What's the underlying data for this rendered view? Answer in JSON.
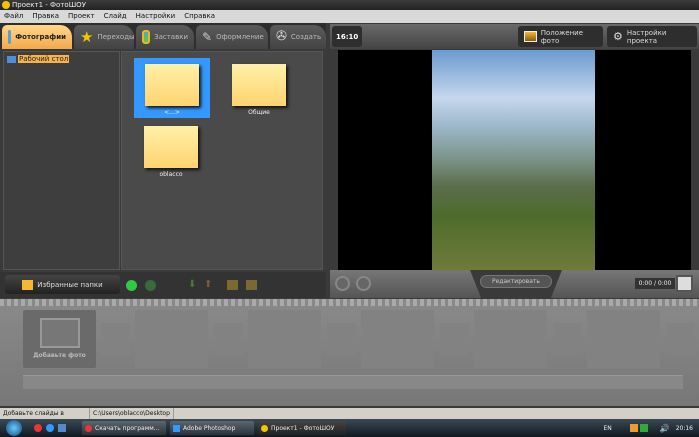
{
  "window": {
    "title": "Проект1 - ФотоШОУ"
  },
  "menu": [
    "Файл",
    "Правка",
    "Проект",
    "Слайд",
    "Настройки",
    "Справка"
  ],
  "tabs": [
    {
      "label": "Фотографии",
      "icon": "photos-icon",
      "active": true
    },
    {
      "label": "Переходы",
      "icon": "star-icon"
    },
    {
      "label": "Заставки",
      "icon": "picture-icon"
    },
    {
      "label": "Оформление",
      "icon": "brush-icon"
    },
    {
      "label": "Создать",
      "icon": "film-reel-icon"
    }
  ],
  "tree": {
    "root": "Рабочий стол"
  },
  "files": [
    {
      "name": "<...>",
      "selected": true
    },
    {
      "name": "Общие"
    },
    {
      "name": "oblacco"
    }
  ],
  "left_toolbar": {
    "favorites": "Избранные папки"
  },
  "preview": {
    "aspect": "16:10",
    "photo_position": "Положение фото",
    "project_settings": "Настройки проекта",
    "edit": "Редактировать",
    "time": "0:00 / 0:00"
  },
  "timeline": {
    "add_photo": "Добавьте фото"
  },
  "status": {
    "hint": "Добавьте слайды в проект...",
    "path": "C:\\Users\\oblacco\\Desktop"
  },
  "taskbar": {
    "items": [
      "Скачать программ...",
      "Adobe Photoshop",
      "Проект1 - ФотоШОУ"
    ],
    "lang": "EN",
    "clock": "20:16"
  }
}
